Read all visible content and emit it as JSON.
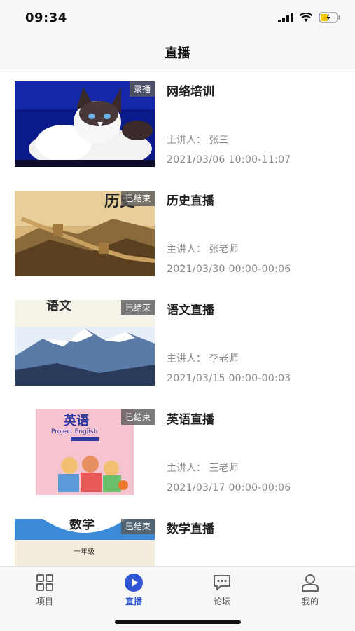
{
  "status": {
    "time": "09:34"
  },
  "header": {
    "title": "直播"
  },
  "items": [
    {
      "badge": "录播",
      "title": "网络培训",
      "lecturer": "主讲人：  张三",
      "time": "2021/03/06 10:00-11:07"
    },
    {
      "badge": "已结束",
      "title": "历史直播",
      "lecturer": "主讲人：  张老师",
      "time": "2021/03/30 00:00-00:06",
      "cover_text": "历史"
    },
    {
      "badge": "已结束",
      "title": "语文直播",
      "lecturer": "主讲人：  李老师",
      "time": "2021/03/15 00:00-00:03",
      "cover_text": "语文"
    },
    {
      "badge": "已结束",
      "title": "英语直播",
      "lecturer": "主讲人：  王老师",
      "time": "2021/03/17 00:00-00:06",
      "cover_text": "英语",
      "cover_sub": "Project English"
    },
    {
      "badge": "已结束",
      "title": "数学直播",
      "cover_text": "数学",
      "cover_sub": "一年级"
    }
  ],
  "tabs": [
    {
      "label": "项目",
      "icon": "grid-icon"
    },
    {
      "label": "直播",
      "icon": "play-icon",
      "active": true
    },
    {
      "label": "论坛",
      "icon": "chat-icon"
    },
    {
      "label": "我的",
      "icon": "user-icon"
    }
  ],
  "colors": {
    "accent": "#2f55d4",
    "badge_bg": "#5a5a5a"
  }
}
